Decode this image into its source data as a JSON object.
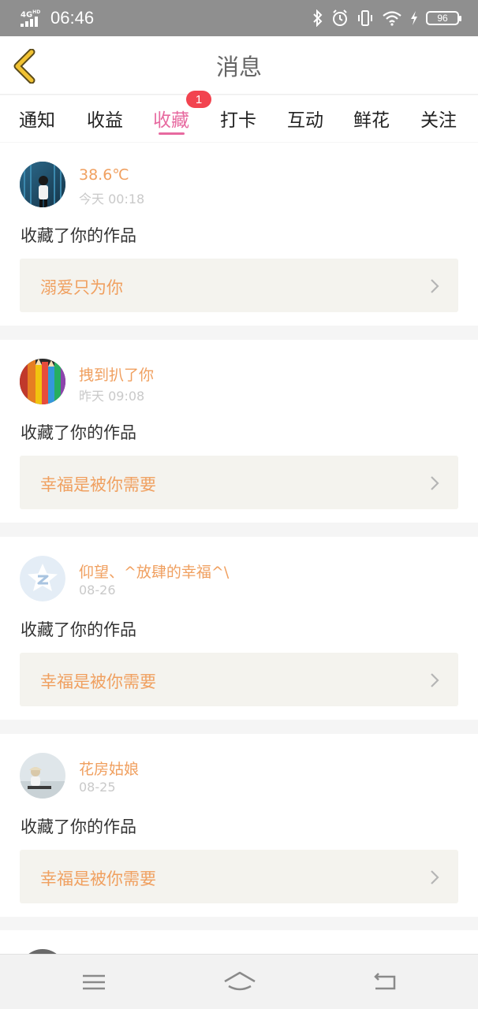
{
  "status_bar": {
    "network": "4G",
    "hd": "HD",
    "time": "06:46",
    "battery": "96",
    "icons": [
      "bluetooth-icon",
      "alarm-icon",
      "vibrate-icon",
      "wifi-icon",
      "charging-icon",
      "battery-icon"
    ]
  },
  "header": {
    "title": "消息",
    "back_icon": "chevron-left-icon"
  },
  "tabs": {
    "items": [
      {
        "label": "通知"
      },
      {
        "label": "收益"
      },
      {
        "label": "收藏"
      },
      {
        "label": "打卡"
      },
      {
        "label": "互动"
      },
      {
        "label": "鲜花"
      },
      {
        "label": "关注"
      }
    ],
    "active": "收藏",
    "badge": "1"
  },
  "messages": [
    {
      "name": "38.6℃",
      "time": "今天 00:18",
      "action": "收藏了你的作品",
      "work": "溺爱只为你",
      "avatar": "avatar-girl-blue"
    },
    {
      "name": "拽到扒了你",
      "time": "昨天 09:08",
      "action": "收藏了你的作品",
      "work": "幸福是被你需要",
      "avatar": "avatar-color-pencils"
    },
    {
      "name": "仰望、^放肆的幸福^\\",
      "time": "08-26",
      "action": "收藏了你的作品",
      "work": "幸福是被你需要",
      "avatar": "avatar-default-qq"
    },
    {
      "name": "花房姑娘",
      "time": "08-25",
      "action": "收藏了你的作品",
      "work": "幸福是被你需要",
      "avatar": "avatar-girl-beach"
    }
  ],
  "bottom_nav": {
    "icons": [
      "menu-icon",
      "home-icon",
      "back-icon"
    ]
  },
  "colors": {
    "accent_pink": "#e76aa0",
    "name_orange": "#f0a060",
    "badge_red": "#f2434f",
    "back_arrow_yellow": "#f1c232",
    "status_bar_gray": "#8f8f8f"
  }
}
